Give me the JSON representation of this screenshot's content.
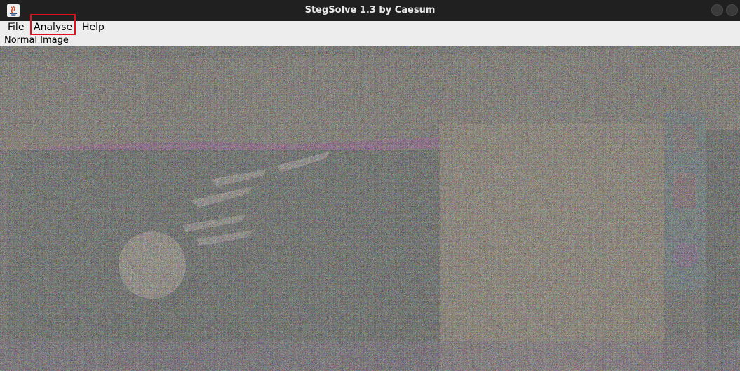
{
  "window": {
    "title": "StegSolve 1.3 by Caesum"
  },
  "menu": {
    "items": [
      {
        "label": "File"
      },
      {
        "label": "Analyse"
      },
      {
        "label": "Help"
      }
    ]
  },
  "view": {
    "mode_label": "Normal Image"
  },
  "colors": {
    "highlight": "#e0131a",
    "titlebar": "#202020",
    "menubar": "#ededed"
  }
}
